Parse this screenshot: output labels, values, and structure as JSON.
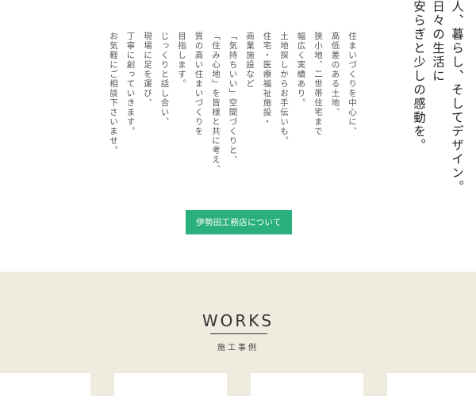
{
  "tagline": {
    "lines": [
      "人、暮らし、そしてデザイン。",
      "日々の生活に",
      "安らぎと少しの感動を。"
    ]
  },
  "intro": {
    "lines": [
      "住まいづくりを中心に、",
      "高低差のある土地、",
      "狭小地、二世帯住宅まで",
      "幅広く実績あり。",
      "土地探しからお手伝いも。",
      "住宅・医療福祉施設・",
      "商業施設など",
      "「気持ちいい」空間づくりと、",
      "「住み心地」を皆様と共に考え、",
      "質の高い住まいづくりを",
      "目指します。",
      "じっくりと話し合い、",
      "現場に足を運び、",
      "丁寧に創っていきます。",
      "お気軽にご相談下さいませ。"
    ]
  },
  "about_button": {
    "label": "伊勢田工務店について"
  },
  "works": {
    "title": "WORKS",
    "subtitle": "施工事例"
  },
  "colors": {
    "accent": "#2bb07d",
    "section_bg": "#efebdf"
  }
}
